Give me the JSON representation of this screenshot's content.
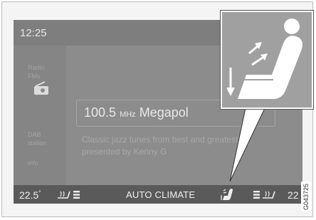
{
  "screen": {
    "clock": "12:25",
    "sidebar_line1": "Radio",
    "sidebar_line2": "FMs",
    "sidebar_line3": "DAB",
    "sidebar_line4": "station",
    "sidebar_line5": "info",
    "station_freq": "100.5",
    "station_unit": "MHz",
    "station_name": "Megapol",
    "radiotext_line1": "Classic jazz tunes from best and greatest",
    "radiotext_line2": "presented by Kenny G"
  },
  "climate_bar": {
    "temp_left": "22.5",
    "label": "AUTO CLIMATE",
    "temp_right": "22"
  },
  "figure_code": "G043725",
  "colors": {
    "screen_bg": "#8c8c8c",
    "climate_bar_bg": "#5a5a5a",
    "zoom_bg": "#a0a0a0"
  },
  "icons": [
    "radio-icon",
    "seat-heat-left-icon",
    "seat-airflow-icon",
    "seat-heat-right-icon",
    "seat-airflow-zoom-icon"
  ]
}
